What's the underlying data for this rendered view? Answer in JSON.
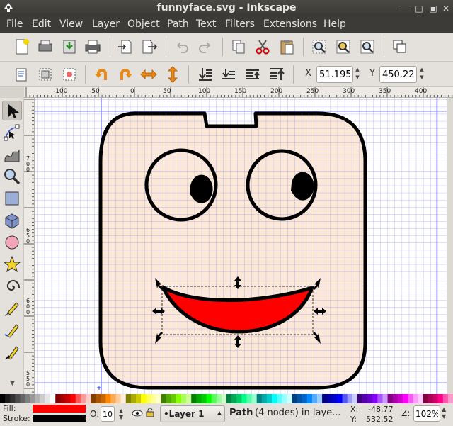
{
  "window": {
    "title": "funnyface.svg - Inkscape"
  },
  "menu": [
    "File",
    "Edit",
    "View",
    "Layer",
    "Object",
    "Path",
    "Text",
    "Filters",
    "Extensions",
    "Help"
  ],
  "coords": {
    "x_label": "X",
    "x_value": "51.195",
    "y_label": "Y",
    "y_value": "450.220"
  },
  "ruler": {
    "h_labels": [
      "-100",
      "-50",
      "0",
      "50",
      "100",
      "150",
      "200",
      "250",
      "300",
      "350",
      "400"
    ],
    "v_labels": [
      "7\n0\n0",
      "6\n5\n0",
      "6\n0\n0",
      "5\n5\n0",
      "5\n0\n0",
      "4\n5\n0"
    ]
  },
  "status": {
    "fill_label": "Fill:",
    "stroke_label": "Stroke:",
    "stroke_width": "5",
    "opacity_label": "O:",
    "opacity_value": "10",
    "layer": "•Layer 1",
    "message_bold": "Path",
    "message_rest": " (4 nodes) in laye...",
    "cursor_x_label": "X:",
    "cursor_x": "-48.77",
    "cursor_y_label": "Y:",
    "cursor_y": "532.52",
    "zoom_label": "Z:",
    "zoom": "102%"
  },
  "colors": {
    "fill": "#ff0000",
    "stroke": "#000000",
    "face": "#fce8d6",
    "grid": "#5a5aff",
    "accent": "#3c3b37"
  },
  "tools": [
    "selector-tool",
    "node-tool",
    "tweak-tool",
    "zoom-tool",
    "rectangle-tool",
    "3dbox-tool",
    "ellipse-tool",
    "star-tool",
    "spiral-tool",
    "pencil-tool",
    "pen-tool",
    "calligraphy-tool"
  ],
  "commands": [
    "new-document",
    "open-document",
    "save-document",
    "print-document",
    "import",
    "export",
    "undo",
    "redo",
    "duplicate",
    "cut",
    "paste",
    "zoom-selection",
    "zoom-drawing",
    "zoom-page",
    "group"
  ],
  "controls": [
    "lower-to-bottom",
    "lower",
    "rotate-ccw",
    "rotate-cw",
    "flip-horizontal",
    "flip-vertical",
    "raise",
    "raise-to-top"
  ]
}
